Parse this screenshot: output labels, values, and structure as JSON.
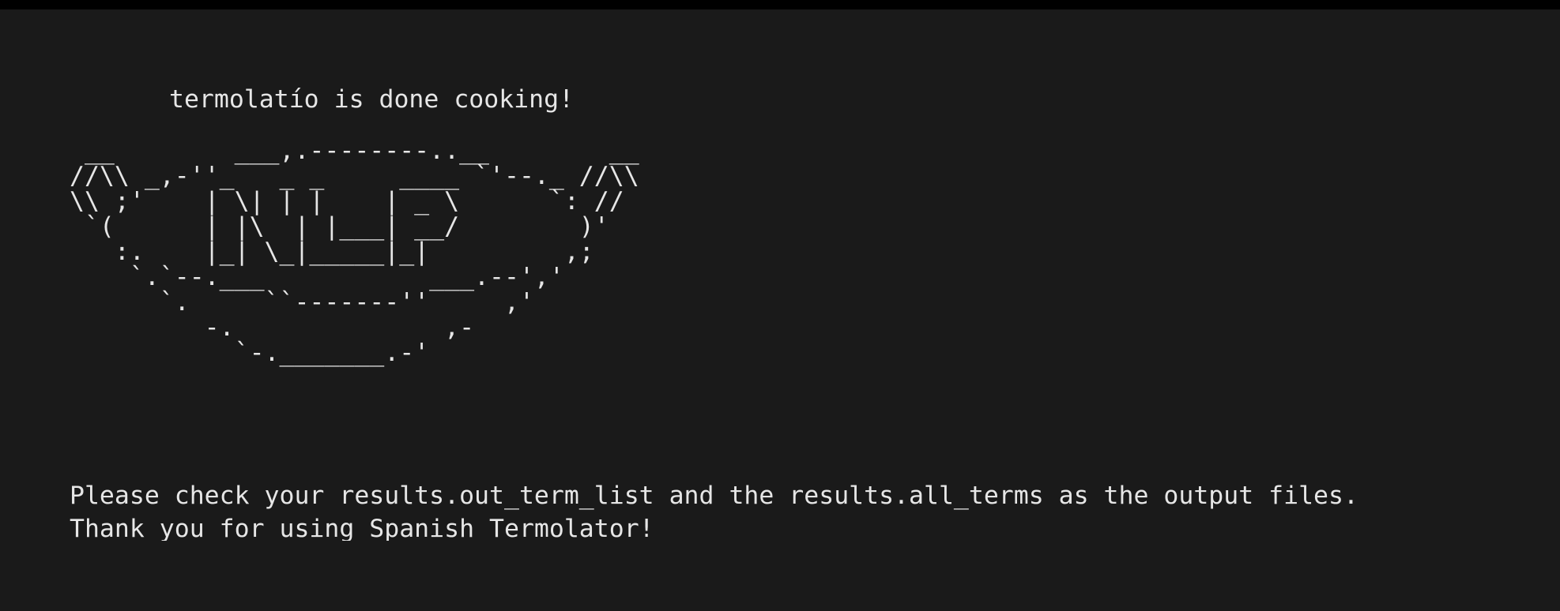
{
  "terminal": {
    "title_line": "termolatío is done cooking!",
    "ascii_logo": " __        ___,.--------..__        __\n//\\\\ _,-''_   _ _     ____ `'--._ //\\\\\n\\\\ ;'    | \\| | |    | _ \\      `: //\n `(      | |\\  | |___| __/        )'\n   :.    |_| \\_|_____|_|         ,;\n    `.`--.___           ___.--','\n      `.     ``-------''     ,'\n         -.              ,-\n           `-._______.-'",
    "message_line_1": "Please check your results.out_term_list and the results.all_terms as the output files.",
    "message_line_2": "Thank you for using Spanish Termolator!"
  },
  "colors": {
    "background": "#1a1a1a",
    "top_bar": "#000000",
    "text": "#e6e6e6"
  }
}
